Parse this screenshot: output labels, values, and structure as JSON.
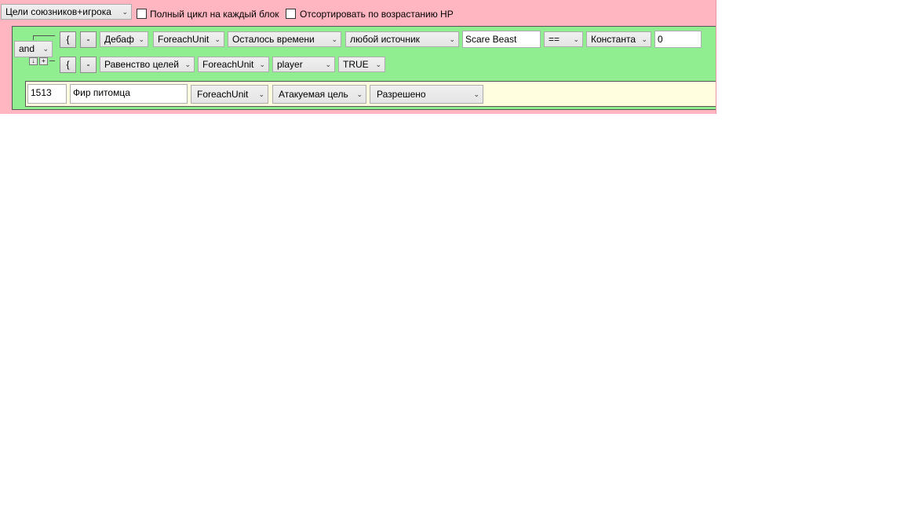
{
  "top_bar": {
    "target_select": "Цели союзников+игрока",
    "full_cycle_label": "Полный цикл на каждый блок",
    "full_cycle_checked": false,
    "sort_hp_label": "Отсортировать по возрастанию HP",
    "sort_hp_checked": false
  },
  "condition_group": {
    "operator": "and",
    "row1": {
      "brace_label": "{",
      "minus_label": "-",
      "type": "Дебаф",
      "unit": "ForeachUnit",
      "property": "Осталось времени",
      "source": "любой источник",
      "spell_name": "Scare Beast",
      "comparator": "==",
      "value_type": "Константа",
      "value": "0"
    },
    "row2": {
      "brace_label": "{",
      "minus_label": "-",
      "type": "Равенство целей",
      "unit": "ForeachUnit",
      "target": "player",
      "value": "TRUE"
    },
    "mini_left": "↓",
    "mini_right": "+"
  },
  "action": {
    "spell_id": "1513",
    "spell_name": "Фир питомца",
    "unit": "ForeachUnit",
    "target": "Атакуемая цель",
    "permission": "Разрешено"
  },
  "icons": {
    "dropdown": "chevron-down-icon"
  },
  "colors": {
    "outer": "#ffb6c1",
    "condition": "#90ee90",
    "action": "#ffffe0"
  }
}
